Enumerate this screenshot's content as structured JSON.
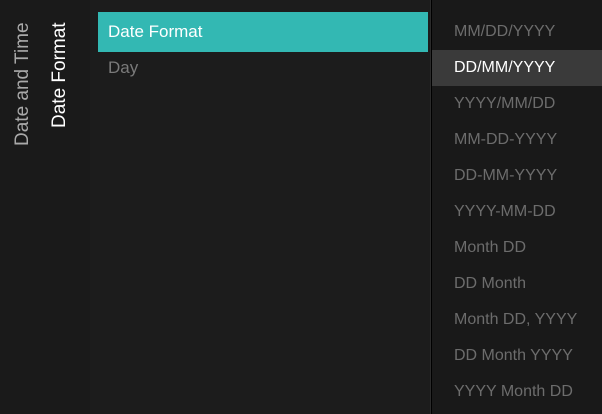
{
  "breadcrumbs": [
    "Date and Time",
    "Date Format"
  ],
  "menu": {
    "items": [
      {
        "label": "Date Format",
        "selected": true
      },
      {
        "label": "Day",
        "selected": false
      }
    ]
  },
  "options": {
    "items": [
      "MM/DD/YYYY",
      "DD/MM/YYYY",
      "YYYY/MM/DD",
      "MM-DD-YYYY",
      "DD-MM-YYYY",
      "YYYY-MM-DD",
      "Month DD",
      "DD Month",
      "Month DD, YYYY",
      "DD Month YYYY",
      "YYYY Month DD"
    ],
    "selected": "DD/MM/YYYY"
  },
  "colors": {
    "accent": "#33b8b3",
    "selected_option_bg": "#3a3a3a"
  }
}
